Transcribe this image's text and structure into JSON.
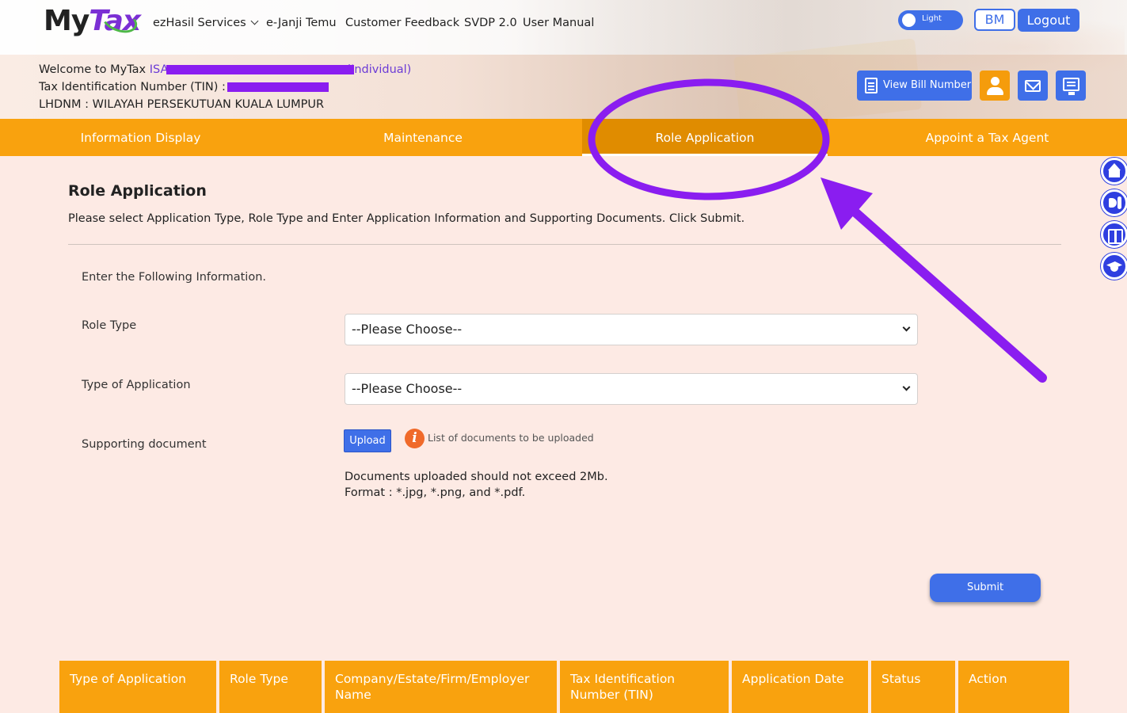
{
  "app": {
    "logo_my": "My",
    "logo_tax": "Tax"
  },
  "nav": {
    "items": [
      {
        "label": "ezHasil Services"
      },
      {
        "label": "e-Janji Temu"
      },
      {
        "label": "Customer Feedback"
      },
      {
        "label": "SVDP 2.0"
      },
      {
        "label": "User Manual"
      }
    ]
  },
  "header_controls": {
    "theme_toggle_label": "Light",
    "language_button": "BM",
    "logout_button": "Logout"
  },
  "user_info": {
    "welcome_prefix": "Welcome to MyTax ",
    "name_visible_start": "ISA",
    "name_suffix": "(Individual)",
    "tin_label": "Tax Identification Number (TIN) : ",
    "lhdnm": "LHDNM : WILAYAH PERSEKUTUAN KUALA LUMPUR",
    "view_bill_button": "View Bill Number"
  },
  "tabs": [
    {
      "label": "Information Display",
      "active": false
    },
    {
      "label": "Maintenance",
      "active": false
    },
    {
      "label": "Role Application",
      "active": true
    },
    {
      "label": "Appoint a Tax Agent",
      "active": false
    }
  ],
  "main": {
    "title": "Role Application",
    "instructions": "Please select Application Type, Role Type and Enter Application Information and Supporting Documents. Click Submit.",
    "form_intro": "Enter the Following Information.",
    "role_type_label": "Role Type",
    "role_type_value": "--Please Choose--",
    "application_type_label": "Type of Application",
    "application_type_value": "--Please Choose--",
    "supporting_doc_label": "Supporting document",
    "upload_button": "Upload",
    "info_icon_glyph": "i",
    "doc_list_label": "List of documents to be uploaded",
    "note_size": "Documents uploaded should not exceed 2Mb.",
    "note_format": "Format : *.jpg, *.png, and *.pdf.",
    "submit_button": "Submit"
  },
  "table": {
    "headers": [
      "Type of Application",
      "Role Type",
      "Company/Estate/Firm/Employer Name",
      "Tax Identification Number (TIN)",
      "Application Date",
      "Status",
      "Action"
    ]
  },
  "colors": {
    "accent_orange": "#f9a20e",
    "active_tab": "#e08c00",
    "brand_blue": "#3f6fe8",
    "annotation_purple": "#8a1df0",
    "background": "#fdeae4"
  },
  "icons": {
    "side_buttons": [
      "home-icon",
      "announcement-icon",
      "book-icon",
      "graduation-cap-icon"
    ],
    "header_buttons": [
      "bill-icon",
      "user-icon",
      "mail-icon",
      "tax-form-icon"
    ]
  }
}
